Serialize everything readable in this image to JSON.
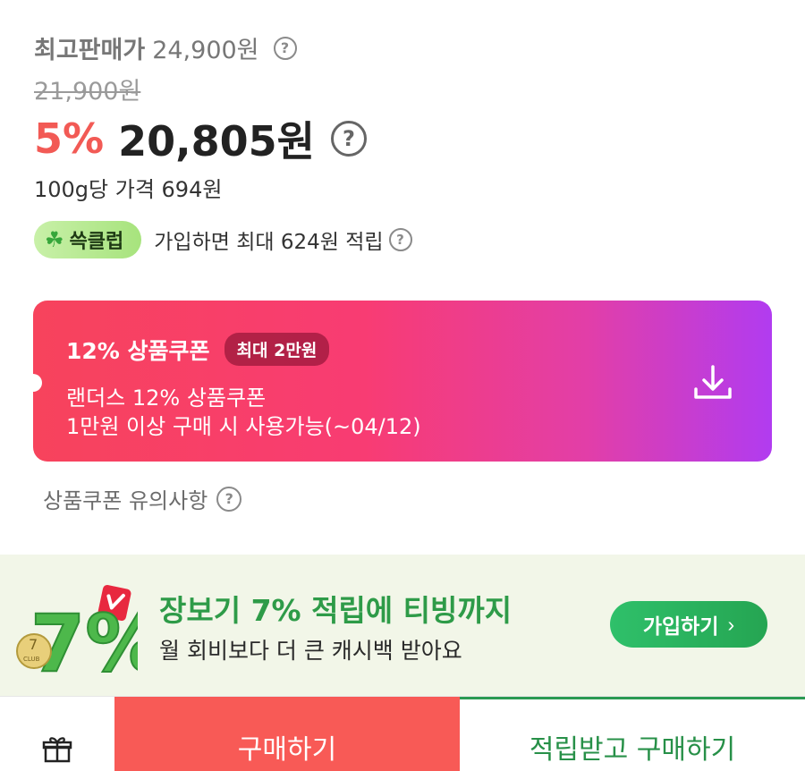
{
  "price": {
    "max_label": "최고판매가",
    "max_value": "24,900원",
    "original": "21,900원",
    "discount_rate": "5%",
    "sale_price": "20,805원",
    "unit_price": "100g당 가격 694원"
  },
  "club": {
    "badge": "쓱클럽",
    "text": "가입하면 최대 624원 적립"
  },
  "coupon": {
    "title": "12% 상품쿠폰",
    "max_badge": "최대 2만원",
    "desc_line1": "랜더스 12% 상품쿠폰",
    "desc_line2": "1만원 이상 구매 시 사용가능(~04/12)",
    "notice": "상품쿠폰 유의사항",
    "gradient_start": "#f7435c",
    "gradient_end": "#b13cf0"
  },
  "promo": {
    "title": "장보기 7% 적립에 티빙까지",
    "subtitle": "월 회비보다 더 큰 캐시백 받아요",
    "button": "가입하기",
    "art_text": "7%",
    "coin_text": "CLUB"
  },
  "bottom": {
    "buy": "구매하기",
    "reward_buy": "적립받고 구매하기"
  },
  "help_glyph": "?",
  "icons": {
    "help": "question-circle-icon",
    "club": "clover-icon",
    "download": "download-icon",
    "gift": "gift-icon",
    "chevron": "chevron-right-icon"
  },
  "colors": {
    "discount": "#f25a55",
    "club_green": "#2e9b48",
    "buy_red": "#f85a56",
    "reward_green": "#279048"
  }
}
